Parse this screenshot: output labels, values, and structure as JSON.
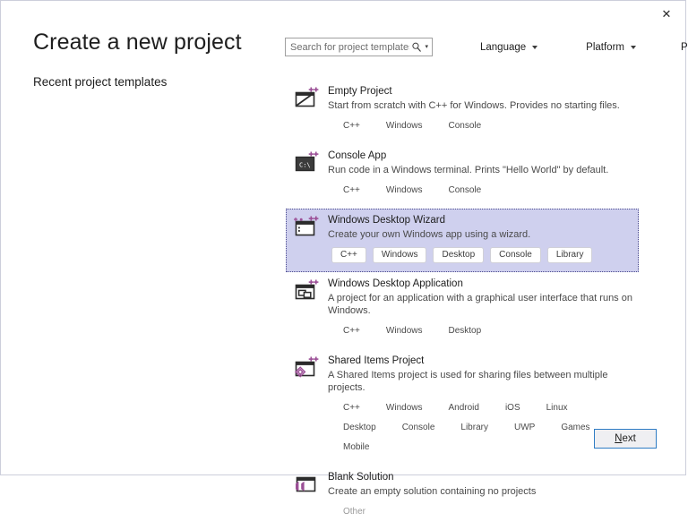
{
  "window": {
    "close_label": "✕"
  },
  "header": {
    "page_title": "Create a new project",
    "recent_title": "Recent project templates"
  },
  "search": {
    "placeholder": "Search for project templates",
    "value": "",
    "icon": "search-icon",
    "dropdown_caret": "▾"
  },
  "filters": [
    {
      "label": "Language"
    },
    {
      "label": "Platform"
    },
    {
      "label": "Project type"
    }
  ],
  "templates": [
    {
      "name": "Empty Project",
      "description": "Start from scratch with C++ for Windows. Provides no starting files.",
      "icon": "empty-project-icon",
      "selected": false,
      "tags": [
        "C++",
        "Windows",
        "Console"
      ]
    },
    {
      "name": "Console App",
      "description": "Run code in a Windows terminal. Prints \"Hello World\" by default.",
      "icon": "console-app-icon",
      "selected": false,
      "tags": [
        "C++",
        "Windows",
        "Console"
      ]
    },
    {
      "name": "Windows Desktop Wizard",
      "description": "Create your own Windows app using a wizard.",
      "icon": "windows-desktop-wizard-icon",
      "selected": true,
      "tags": [
        "C++",
        "Windows",
        "Desktop",
        "Console",
        "Library"
      ]
    },
    {
      "name": "Windows Desktop Application",
      "description": "A project for an application with a graphical user interface that runs on Windows.",
      "icon": "windows-desktop-application-icon",
      "selected": false,
      "tags": [
        "C++",
        "Windows",
        "Desktop"
      ]
    },
    {
      "name": "Shared Items Project",
      "description": "A Shared Items project is used for sharing files between multiple projects.",
      "icon": "shared-items-project-icon",
      "selected": false,
      "tags": [
        "C++",
        "Windows",
        "Android",
        "iOS",
        "Linux",
        "Desktop",
        "Console",
        "Library",
        "UWP",
        "Games",
        "Mobile"
      ]
    },
    {
      "name": "Blank Solution",
      "description": "Create an empty solution containing no projects",
      "icon": "blank-solution-icon",
      "selected": false,
      "tags": [
        "Other"
      ],
      "tags_muted": true
    }
  ],
  "footer": {
    "next_accel": "N",
    "next_rest": "ext"
  },
  "colors": {
    "selection_background": "#cfd0ee",
    "selection_border": "#4b4b8f",
    "focus_button_border": "#2f7cc4",
    "icon_accent_purple": "#9b4f96",
    "icon_outline": "#2b2b2b"
  }
}
